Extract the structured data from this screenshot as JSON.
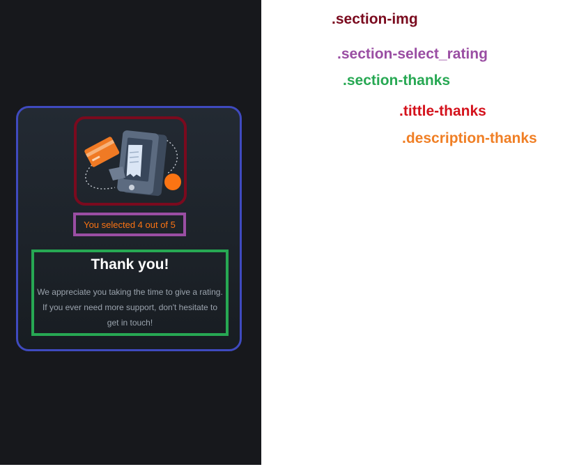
{
  "card": {
    "rating_text": "You selected 4 out of 5",
    "title": "Thank you!",
    "description": "We appreciate you taking the time to give a rating. If you ever need more support, don't hesitate to get in touch!"
  },
  "annotations": [
    {
      "label": ".section-img",
      "color": "#7a0a1e"
    },
    {
      "label": ".section-select_rating",
      "color": "#9a4ea3"
    },
    {
      "label": ".section-thanks",
      "color": "#27a853"
    },
    {
      "label": ".tittle-thanks",
      "color": "#d4121c"
    },
    {
      "label": ".description-thanks",
      "color": "#f07f25"
    }
  ],
  "colors": {
    "panel_bg": "#17181c",
    "card_border": "#3f4abf",
    "accent_orange": "#fb7413",
    "section_img_outline": "#7a0a1e",
    "section_select_outline": "#9a4ea3",
    "section_thanks_outline": "#27a853"
  },
  "icons": [
    "payment-illustration-icon"
  ]
}
